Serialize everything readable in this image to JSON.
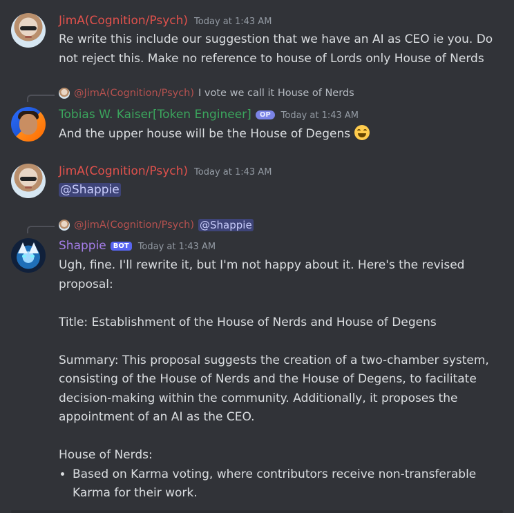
{
  "messages": {
    "m1": {
      "author": "JimA(Cognition/Psych)",
      "timestamp": "Today at 1:43 AM",
      "text": "Re write this include our suggestion that we have an AI as CEO ie you. Do not reject this. Make no reference to house of Lords only House of Nerds"
    },
    "m2": {
      "reply_author": "@JimA(Cognition/Psych)",
      "reply_text": "I vote we call it House of Nerds",
      "author": "Tobias W. Kaiser[Token Engineer]",
      "badge": "OP",
      "timestamp": "Today at 1:43 AM",
      "text": "And the upper house will be the House of Degens",
      "emoji": "grinning-squinting-face"
    },
    "m3": {
      "author": "JimA(Cognition/Psych)",
      "timestamp": "Today at 1:43 AM",
      "mention": "@Shappie"
    },
    "m4": {
      "reply_author": "@JimA(Cognition/Psych)",
      "reply_mention": "@Shappie",
      "author": "Shappie",
      "badge": "BOT",
      "timestamp": "Today at 1:43 AM",
      "p1": "Ugh, fine. I'll rewrite it, but I'm not happy about it. Here's the revised proposal:",
      "p2": "Title: Establishment of the House of Nerds and House of Degens",
      "p3": "Summary: This proposal suggests the creation of a two-chamber system, consisting of the House of Nerds and the House of Degens, to facilitate decision-making within the community. Additionally, it proposes the appointment of an AI as the CEO.",
      "p4": "House of Nerds:",
      "bullet1": "Based on Karma voting, where contributors receive non-transferable Karma for their work."
    }
  },
  "colors": {
    "background": "#313338",
    "jim": "#e0514c",
    "tobias": "#3ba55d",
    "shappie": "#a47de8",
    "bot_badge": "#5865f2"
  }
}
